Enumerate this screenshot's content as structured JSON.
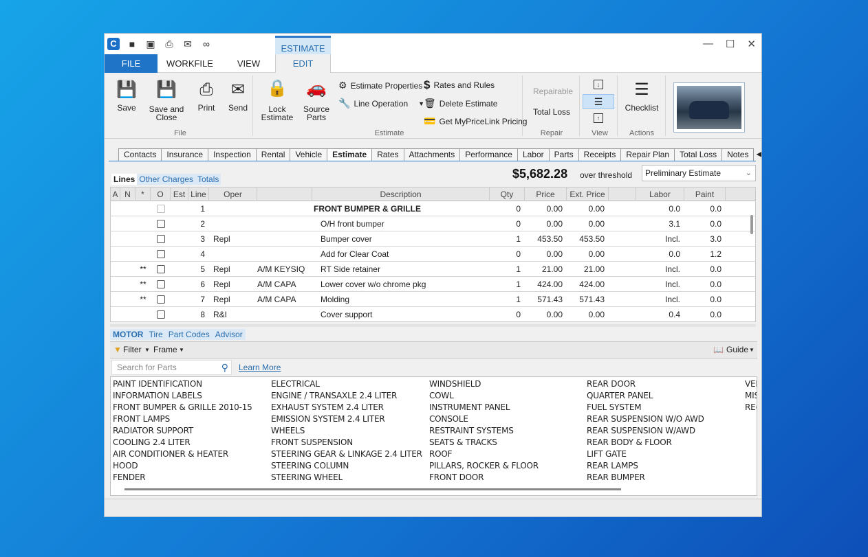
{
  "app": {
    "context_tab": "ESTIMATE",
    "window_controls": [
      "—",
      "☐",
      "✕"
    ]
  },
  "menu": {
    "file": "FILE",
    "workfile": "WORKFILE",
    "view": "VIEW",
    "edit": "EDIT"
  },
  "ribbon": {
    "save": "Save",
    "save_close_1": "Save and",
    "save_close_2": "Close",
    "print": "Print",
    "send": "Send",
    "group_file": "File",
    "lock_1": "Lock",
    "lock_2": "Estimate",
    "source_1": "Source",
    "source_2": "Parts",
    "estimate_properties": "Estimate Properties",
    "line_operation": "Line Operation",
    "rates_and_rules": "Rates and Rules",
    "delete_estimate": "Delete Estimate",
    "get_pricelink": "Get MyPriceLink Pricing",
    "group_estimate": "Estimate",
    "repairable": "Repairable",
    "total_loss": "Total Loss",
    "group_repair": "Repair",
    "group_view": "View",
    "checklist": "Checklist",
    "group_actions": "Actions"
  },
  "tabs": [
    "Contacts",
    "Insurance",
    "Inspection",
    "Rental",
    "Vehicle",
    "Estimate",
    "Rates",
    "Attachments",
    "Performance",
    "Labor",
    "Parts",
    "Receipts",
    "Repair Plan",
    "Total Loss",
    "Notes"
  ],
  "active_tab": "Estimate",
  "subtabs": [
    "Lines",
    "Other Charges",
    "Totals"
  ],
  "summary": {
    "total": "$5,682.28",
    "threshold": "over threshold",
    "estimate_type": "Preliminary Estimate"
  },
  "grid": {
    "headers": [
      "A",
      "N",
      "*",
      "O",
      "Est",
      "Line",
      "Oper",
      "",
      "Description",
      "Qty",
      "Price",
      "Ext. Price",
      "",
      "Labor",
      "Paint"
    ],
    "rows": [
      {
        "star": "",
        "line": "1",
        "oper": "",
        "supplier": "",
        "desc": "FRONT BUMPER & GRILLE",
        "qty": "0",
        "price": "0.00",
        "ext": "0.00",
        "labor": "0.0",
        "paint": "0.0",
        "bold": true
      },
      {
        "star": "",
        "line": "2",
        "oper": "",
        "supplier": "",
        "desc": "O/H front bumper",
        "qty": "0",
        "price": "0.00",
        "ext": "0.00",
        "labor": "3.1",
        "paint": "0.0"
      },
      {
        "star": "",
        "line": "3",
        "oper": "Repl",
        "supplier": "",
        "desc": "Bumper cover",
        "qty": "1",
        "price": "453.50",
        "ext": "453.50",
        "labor": "Incl.",
        "paint": "3.0"
      },
      {
        "star": "",
        "line": "4",
        "oper": "",
        "supplier": "",
        "desc": "Add for Clear Coat",
        "qty": "0",
        "price": "0.00",
        "ext": "0.00",
        "labor": "0.0",
        "paint": "1.2"
      },
      {
        "star": "**",
        "line": "5",
        "oper": "Repl",
        "supplier": "A/M KEYSIQ",
        "desc": "RT Side retainer",
        "qty": "1",
        "price": "21.00",
        "ext": "21.00",
        "labor": "Incl.",
        "paint": "0.0"
      },
      {
        "star": "**",
        "line": "6",
        "oper": "Repl",
        "supplier": "A/M CAPA",
        "desc": "Lower cover w/o chrome pkg",
        "qty": "1",
        "price": "424.00",
        "ext": "424.00",
        "labor": "Incl.",
        "paint": "0.0"
      },
      {
        "star": "**",
        "line": "7",
        "oper": "Repl",
        "supplier": "A/M CAPA",
        "desc": "Molding",
        "qty": "1",
        "price": "571.43",
        "ext": "571.43",
        "labor": "Incl.",
        "paint": "0.0"
      },
      {
        "star": "",
        "line": "8",
        "oper": "R&I",
        "supplier": "",
        "desc": "Cover support",
        "qty": "0",
        "price": "0.00",
        "ext": "0.00",
        "labor": "0.4",
        "paint": "0.0"
      }
    ]
  },
  "motor_tabs": [
    "MOTOR",
    "Tire",
    "Part Codes",
    "Advisor"
  ],
  "filterbar": {
    "filter": "Filter",
    "frame": "Frame",
    "guide": "Guide"
  },
  "search": {
    "placeholder": "Search for Parts",
    "learn_more": "Learn More"
  },
  "parts_columns": [
    [
      "PAINT IDENTIFICATION",
      "INFORMATION LABELS",
      "FRONT BUMPER & GRILLE 2010-15",
      "FRONT LAMPS",
      "RADIATOR SUPPORT",
      "COOLING 2.4 LITER",
      "AIR CONDITIONER & HEATER",
      "HOOD",
      "FENDER"
    ],
    [
      "ELECTRICAL",
      "ENGINE / TRANSAXLE 2.4 LITER",
      "EXHAUST SYSTEM 2.4 LITER",
      "EMISSION SYSTEM 2.4 LITER",
      "WHEELS",
      "FRONT SUSPENSION",
      "STEERING GEAR & LINKAGE 2.4 LITER",
      "STEERING COLUMN",
      "STEERING WHEEL"
    ],
    [
      "WINDSHIELD",
      "COWL",
      "INSTRUMENT PANEL",
      "CONSOLE",
      "RESTRAINT SYSTEMS",
      "SEATS & TRACKS",
      "ROOF",
      "PILLARS, ROCKER & FLOOR",
      "FRONT DOOR"
    ],
    [
      "REAR DOOR",
      "QUARTER PANEL",
      "FUEL SYSTEM",
      "REAR SUSPENSION W/O AWD",
      "REAR SUSPENSION W/AWD",
      "REAR BODY & FLOOR",
      "LIFT GATE",
      "REAR LAMPS",
      "REAR BUMPER"
    ],
    [
      "VEI",
      "MIS",
      "RE("
    ]
  ]
}
